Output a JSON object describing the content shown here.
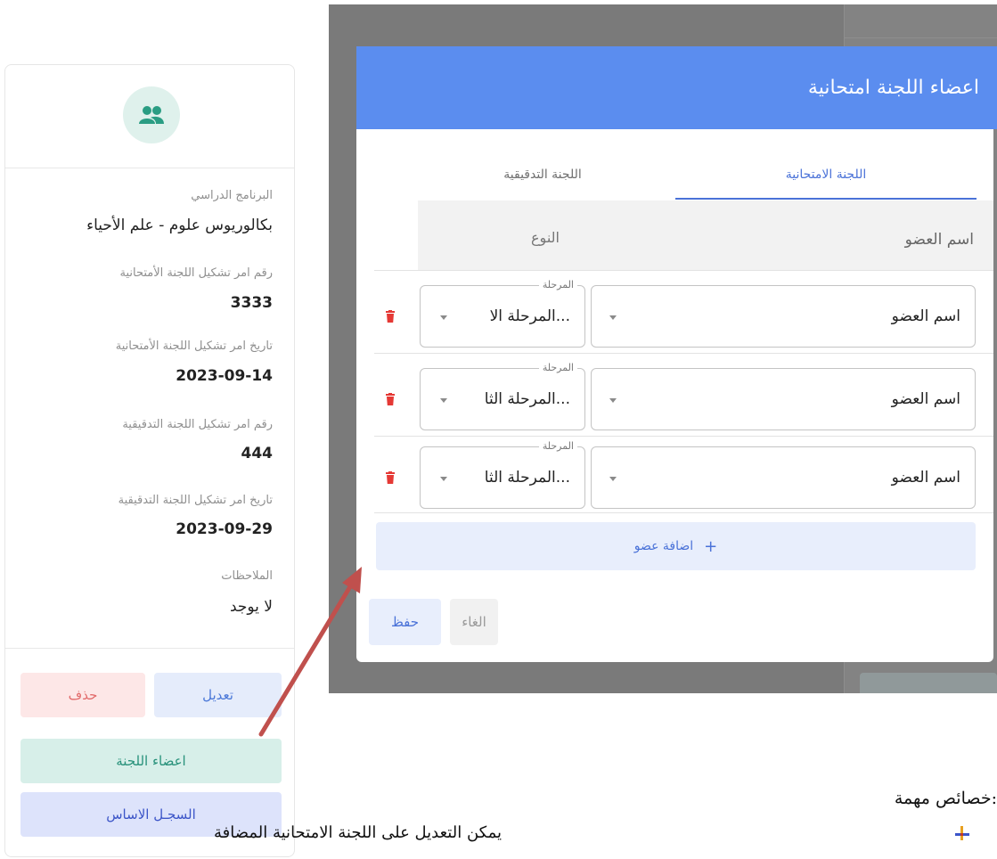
{
  "card": {
    "icon": "users-icon",
    "fields": [
      {
        "label": "البرنامج الدراسي",
        "value": "بكالوريوس علوم - علم الأحياء"
      },
      {
        "label": "رقم امر تشكيل اللجنة الأمتحانية",
        "value": "3333"
      },
      {
        "label": "تاريخ امر تشكيل اللجنة الأمتحانية",
        "value": "2023-09-14"
      },
      {
        "label": "رقم امر تشكيل اللجنة التدقيقية",
        "value": "444"
      },
      {
        "label": "تاريخ امر تشكيل اللجنة التدقيقية",
        "value": "2023-09-29"
      },
      {
        "label": "الملاحظات",
        "value": "لا يوجد"
      }
    ],
    "buttons": {
      "edit": "تعديل",
      "delete": "حذف",
      "members": "اعضاء اللجنة",
      "record": "السجـل الاساس"
    },
    "colors": {
      "avatar_bg": "#dff1ec",
      "avatar_icon": "#2a9d83",
      "edit_bg": "#e5ecfb",
      "edit_fg": "#4b78d8",
      "delete_bg": "#fde7e7",
      "delete_fg": "#e26a6a",
      "members_bg": "#d7efe9",
      "members_fg": "#27917a",
      "record_bg": "#dde3fb",
      "record_fg": "#3c55c8"
    }
  },
  "modal": {
    "title": "اعضاء اللجنة امتحانية",
    "header_color": "#5b8def",
    "tabs": [
      {
        "label": "اللجنة الامتحانية",
        "active": true
      },
      {
        "label": "اللجنة التدقيقية",
        "active": false
      }
    ],
    "columns": {
      "member": "اسم العضو",
      "type": "النوع"
    },
    "rows": [
      {
        "member": "اسم العضو",
        "stage_legend": "المرحلة",
        "stage": "المرحلة الا..."
      },
      {
        "member": "اسم العضو",
        "stage_legend": "المرحلة",
        "stage": "المرحلة الثا..."
      },
      {
        "member": "اسم العضو",
        "stage_legend": "المرحلة",
        "stage": "المرحلة الثا..."
      }
    ],
    "add_member": "اضافة عضو",
    "add_icon": "plus-icon",
    "row_delete_icon": "trash-icon",
    "cancel": "الغاء",
    "save": "حفظ",
    "accent": "#4a72d8",
    "delete_color": "#e53935"
  },
  "annotation": {
    "arrow_color": "#c0504d"
  },
  "doc": {
    "heading": "خصائص مهمة:",
    "bullet": "يمكن التعديل على اللجنة الامتحانية المضافة",
    "bullet_icon": "arrow-bullet-icon"
  }
}
